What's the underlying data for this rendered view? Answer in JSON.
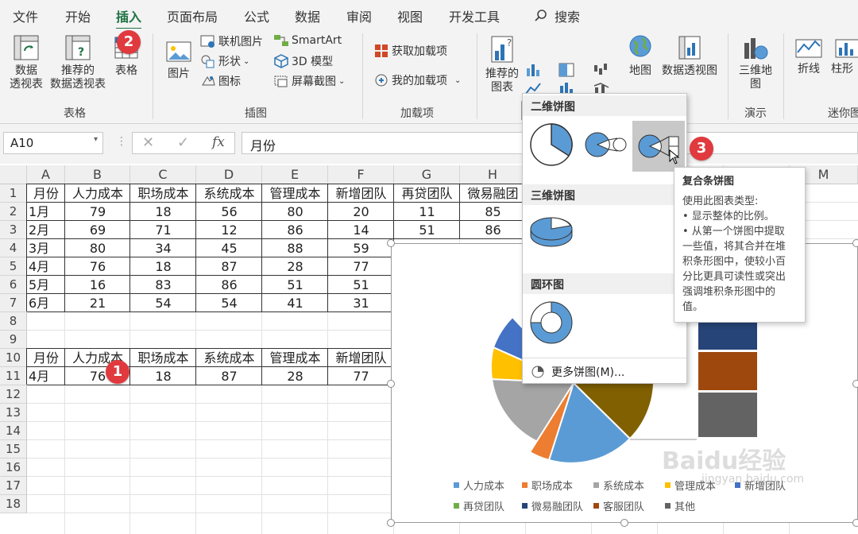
{
  "tabs": [
    "文件",
    "开始",
    "插入",
    "页面布局",
    "公式",
    "数据",
    "审阅",
    "视图",
    "开发工具"
  ],
  "active_tab": "插入",
  "search_label": "搜索",
  "ribbon": {
    "pivot_table": "数据\n透视表",
    "pivot_table_l1": "数据",
    "pivot_table_l2": "透视表",
    "rec_pivot_l1": "推荐的",
    "rec_pivot_l2": "数据透视表",
    "table": "表格",
    "group_tables": "表格",
    "picture": "图片",
    "online_picture": "联机图片",
    "shapes": "形状",
    "icons": "图标",
    "smartart": "SmartArt",
    "model3d": "3D 模型",
    "screenshot": "屏幕截图",
    "group_illustrations": "插图",
    "get_addins": "获取加载项",
    "my_addins": "我的加载项",
    "group_addins": "加载项",
    "rec_charts_l1": "推荐的",
    "rec_charts_l2": "图表",
    "maps": "地图",
    "pivot_chart": "数据透视图",
    "map3d_l1": "三维地",
    "map3d_l2": "图",
    "group_tours": "演示",
    "line": "折线",
    "column": "柱形",
    "group_sparklines": "迷你图"
  },
  "namebox": "A10",
  "formula_value": "月份",
  "columns": [
    "A",
    "B",
    "C",
    "D",
    "E",
    "F",
    "G",
    "H",
    "",
    "",
    "",
    "",
    "M"
  ],
  "rows": [
    "1",
    "2",
    "3",
    "4",
    "5",
    "6",
    "7",
    "8",
    "9",
    "10",
    "11",
    "12",
    "13",
    "14",
    "15",
    "16",
    "17",
    "18"
  ],
  "table1": {
    "header": [
      "月份",
      "人力成本",
      "职场成本",
      "系统成本",
      "管理成本",
      "新增团队",
      "再贷团队",
      "微易融团"
    ],
    "rows": [
      [
        "1月",
        "79",
        "18",
        "56",
        "80",
        "20",
        "11",
        "85"
      ],
      [
        "2月",
        "69",
        "71",
        "12",
        "86",
        "14",
        "51",
        "86"
      ],
      [
        "3月",
        "80",
        "34",
        "45",
        "88",
        "59",
        "",
        ""
      ],
      [
        "4月",
        "76",
        "18",
        "87",
        "28",
        "77",
        "",
        ""
      ],
      [
        "5月",
        "16",
        "83",
        "86",
        "51",
        "51",
        "",
        ""
      ],
      [
        "6月",
        "21",
        "54",
        "54",
        "41",
        "31",
        "",
        ""
      ]
    ]
  },
  "table2": {
    "header": [
      "月份",
      "人力成本",
      "职场成本",
      "系统成本",
      "管理成本",
      "新增团队"
    ],
    "row": [
      "4月",
      "76",
      "18",
      "87",
      "28",
      "77"
    ]
  },
  "badges": [
    "1",
    "2",
    "3"
  ],
  "dropdown": {
    "section_2d": "二维饼图",
    "section_3d": "三维饼图",
    "section_donut": "圆环图",
    "more": "更多饼图(M)..."
  },
  "tooltip": {
    "title": "复合条饼图",
    "lines": [
      "使用此图表类型:",
      "• 显示整体的比例。",
      "• 从第一个饼图中提取",
      "一些值，将其合并在堆",
      "积条形图中，使较小百",
      "分比更具可读性或突出",
      "强调堆积条形图中的",
      "值。"
    ]
  },
  "legend": [
    {
      "label": "人力成本",
      "color": "#5b9bd5"
    },
    {
      "label": "职场成本",
      "color": "#ed7d31"
    },
    {
      "label": "系统成本",
      "color": "#a5a5a5"
    },
    {
      "label": "管理成本",
      "color": "#ffc000"
    },
    {
      "label": "新增团队",
      "color": "#4472c4"
    },
    {
      "label": "再贷团队",
      "color": "#70ad47"
    },
    {
      "label": "微易融团队",
      "color": "#264478"
    },
    {
      "label": "客服团队",
      "color": "#9e480e"
    },
    {
      "label": "其他",
      "color": "#636363"
    }
  ],
  "legend_visible": [
    "人力成本",
    "职场成本",
    "系统成本",
    "管理成本",
    "新增团队",
    "再贷团队",
    "微易融团队",
    "客服团队",
    "其他"
  ],
  "watermark": "Baidu经验",
  "watermark_url": "jingyan.baidu.com",
  "colors": {
    "excel_green": "#217346",
    "badge_red": "#e0393e",
    "selected_bg": "#c8c8c8"
  }
}
